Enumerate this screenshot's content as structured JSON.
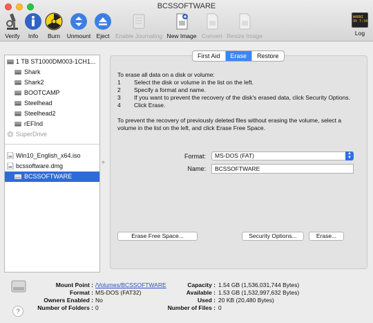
{
  "window": {
    "title": "BCSSOFTWARE"
  },
  "toolbar": {
    "verify": "Verify",
    "info": "Info",
    "burn": "Burn",
    "unmount": "Unmount",
    "eject": "Eject",
    "enable_journaling": "Enable Journaling",
    "new_image": "New Image",
    "convert": "Convert",
    "resize_image": "Resize Image",
    "log": "Log",
    "log_icon_text": "WARNI\n9V 7:34"
  },
  "sidebar": {
    "items": [
      {
        "label": "1 TB ST1000DM003-1CH1..."
      },
      {
        "label": "Shark"
      },
      {
        "label": "Shark2"
      },
      {
        "label": "BOOTCAMP"
      },
      {
        "label": "Steelhead"
      },
      {
        "label": "Steelhead2"
      },
      {
        "label": "rEFInd"
      },
      {
        "label": "SuperDrive"
      },
      {
        "label": "Win10_English_x64.iso"
      },
      {
        "label": "bcssoftware.dmg"
      },
      {
        "label": "BCSSOFTWARE"
      }
    ],
    "splitter_glyph": "⋄"
  },
  "tabs": [
    "First Aid",
    "Erase",
    "Restore"
  ],
  "erase": {
    "intro": "To erase all data on a disk or volume:",
    "steps": [
      {
        "num": "1",
        "text": "Select the disk or volume in the list on the left."
      },
      {
        "num": "2",
        "text": "Specify a format and name."
      },
      {
        "num": "3",
        "text": "If you want to prevent the recovery of the disk's erased data, click Security Options."
      },
      {
        "num": "4",
        "text": "Click Erase."
      }
    ],
    "note": "To prevent the recovery of previously deleted files without erasing the volume, select a volume in the list on the left, and click Erase Free Space.",
    "format_label": "Format:",
    "format_value": "MS-DOS (FAT)",
    "name_label": "Name:",
    "name_value": "BCSSOFTWARE",
    "erase_free_space": "Erase Free Space...",
    "security_options": "Security Options...",
    "erase_button": "Erase..."
  },
  "info": {
    "mount_point_label": "Mount Point :",
    "mount_point": "/Volumes/BCSSOFTWARE",
    "format_label": "Format :",
    "format": "MS-DOS (FAT32)",
    "owners_label": "Owners Enabled :",
    "owners": "No",
    "folders_label": "Number of Folders :",
    "folders": "0",
    "capacity_label": "Capacity :",
    "capacity": "1.54 GB (1,536,031,744 Bytes)",
    "available_label": "Available :",
    "available": "1.53 GB (1,532,997,632 Bytes)",
    "used_label": "Used :",
    "used": "20 KB (20,480 Bytes)",
    "files_label": "Number of Files :",
    "files": "0",
    "help_glyph": "?"
  },
  "colors": {
    "selection": "#2e6bd8",
    "tab_active": "#3a87f5",
    "link": "#2a4fc2"
  }
}
